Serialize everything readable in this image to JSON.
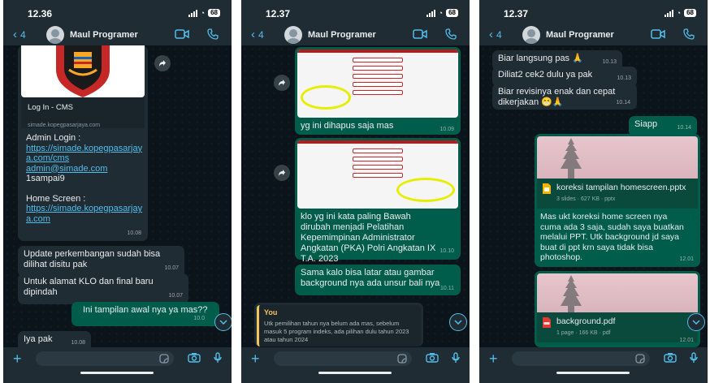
{
  "contact": "Maul Programer",
  "back_count": "4",
  "screens": [
    {
      "time": "12.36",
      "battery": "68",
      "link_preview": {
        "title": "Log In - CMS",
        "domain": "simade.kopegpasarjaya.com"
      },
      "msg1": {
        "admin_title": "Admin Login :",
        "admin_link": "https://simade.kopegpasarjaya.com/cms",
        "admin_email": "admin@simade.com",
        "admin_pass": "1sampai9",
        "home_title": "Home Screen :",
        "home_link": "https://simade.kopegpasarjaya.com",
        "time": "10.08"
      },
      "msg2": {
        "text": "Update perkembangan sudah bisa dilihat disitu pak",
        "time": "10.07"
      },
      "msg3": {
        "text": "Untuk alamat KLO dan final baru dipindah",
        "time": "10.07"
      },
      "msg4": {
        "text": "Ini tampilan awal nya ya mas??",
        "time": "10.0"
      },
      "msg5": {
        "text": "Iya pak",
        "time": "10.08"
      }
    },
    {
      "time": "12.37",
      "battery": "68",
      "msg1": {
        "text": "yg ini dihapus saja mas",
        "time": "10.09"
      },
      "msg2": {
        "text": "klo yg ini kata paling Bawah dirubah menjadi Pelatihan Kepemimpinan Administrator Angkatan (PKA) Polri Angkatan IX T.A. 2023",
        "time": "10.10"
      },
      "msg3": {
        "text": "Sama kalo bisa latar atau gambar background nya ada unsur bali nya",
        "time": "10.11"
      },
      "reply": {
        "name": "You",
        "text": "Utk pemilihan tahun nya belum ada mas, sebelum masuk 5 program indeks, ada pilihan dulu tahun 2023 atau tahun 2024"
      }
    },
    {
      "time": "12.37",
      "battery": "68",
      "msg1": {
        "text": "Biar langsung pas 🙏",
        "time": "10.13"
      },
      "msg2": {
        "text": "Diliat2 cek2 dulu ya pak",
        "time": "10.13"
      },
      "msg3": {
        "text": "Biar revisinya enak dan cepat dikerjakan 😁🙏",
        "time": "10.14"
      },
      "msg4": {
        "text": "Siapp",
        "time": "10.14"
      },
      "doc1": {
        "name": "koreksi tampilan homescreen.pptx",
        "meta": "3 slides · 627 KB · pptx"
      },
      "msg5": {
        "text": "Mas ukt koreksi home screen nya cuma ada 3 saja, sudah saya buatkan melalui PPT. Utk background jd saya buat di ppt krn saya tidak bisa photoshop.",
        "time": "12.01"
      },
      "doc2": {
        "name": "background.pdf",
        "meta": "1 page · 166 KB · pdf",
        "time": "12.01"
      }
    }
  ],
  "colors": {
    "bg": "#0b141a",
    "bar": "#1f2c34",
    "incoming": "#202c33",
    "outgoing": "#005c4b",
    "accent": "#53bdeb"
  }
}
